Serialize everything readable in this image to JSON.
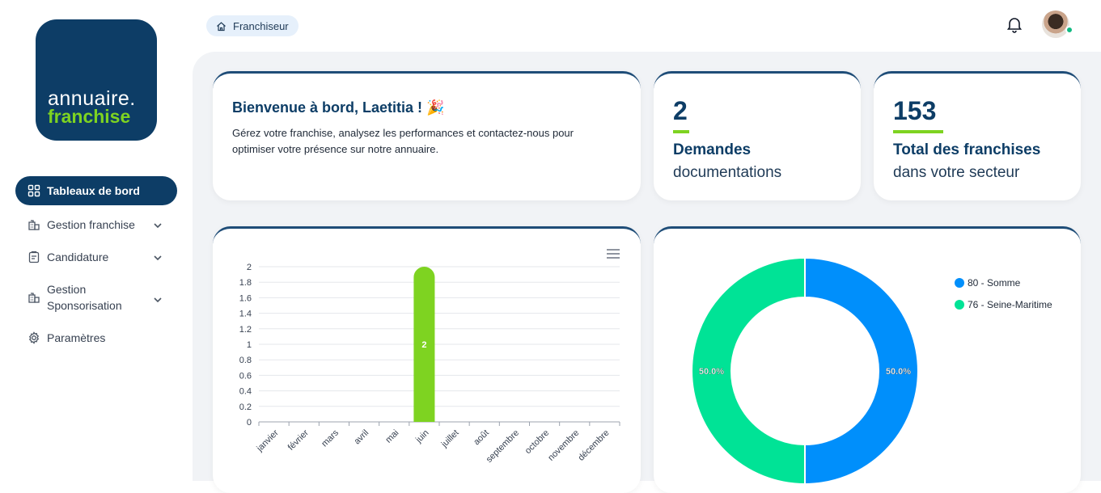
{
  "logo": {
    "line1": "annuaire.",
    "line2": "franchise"
  },
  "nav": [
    {
      "label": "Tableaux de bord",
      "active": true
    },
    {
      "label": "Gestion franchise"
    },
    {
      "label": "Candidature"
    },
    {
      "label": "Gestion Sponsorisation"
    },
    {
      "label": "Paramètres"
    }
  ],
  "breadcrumb": {
    "label": "Franchiseur"
  },
  "welcome": {
    "title": "Bienvenue à bord, Laetitia ! 🎉",
    "text": "Gérez votre franchise, analysez les performances et contactez-nous pour optimiser votre présence sur notre annuaire."
  },
  "stats": [
    {
      "number": "2",
      "label1": "Demandes",
      "label2": "documentations"
    },
    {
      "number": "153",
      "label1": "Total des franchises",
      "label2": "dans votre secteur"
    }
  ],
  "colors": {
    "brand": "#0d3d66",
    "accent": "#7ed321",
    "blue": "#008ffb",
    "green": "#00e396"
  },
  "chart_data": [
    {
      "type": "bar",
      "categories": [
        "janvier",
        "février",
        "mars",
        "avril",
        "mai",
        "juin",
        "juillet",
        "août",
        "septembre",
        "octobre",
        "novembre",
        "décembre"
      ],
      "values": [
        0,
        0,
        0,
        0,
        0,
        2,
        0,
        0,
        0,
        0,
        0,
        0
      ],
      "ylim": [
        0,
        2
      ],
      "yticks": [
        "0",
        "0.2",
        "0.4",
        "0.6",
        "0.8",
        "1",
        "1.2",
        "1.4",
        "1.6",
        "1.8",
        "2"
      ],
      "data_labels": [
        "2"
      ],
      "grid": true
    },
    {
      "type": "pie",
      "labels": [
        "80 - Somme",
        "76 - Seine-Maritime"
      ],
      "values": [
        50.0,
        50.0
      ],
      "value_labels": [
        "50.0%",
        "50.0%"
      ],
      "legend": "top-right"
    }
  ]
}
